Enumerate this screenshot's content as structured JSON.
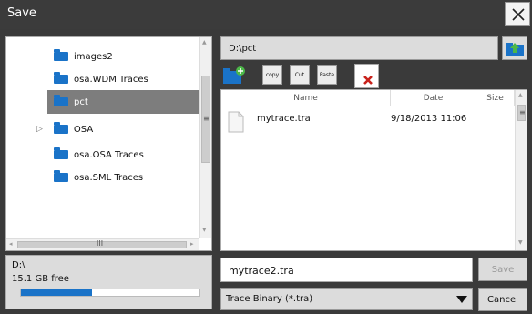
{
  "window": {
    "title": "Save"
  },
  "tree": {
    "items": [
      {
        "label": "images2"
      },
      {
        "label": "osa.WDM Traces"
      },
      {
        "label": "pct",
        "selected": true
      },
      {
        "label": "OSA",
        "expandable": true
      },
      {
        "label": "osa.OSA Traces"
      },
      {
        "label": "osa.SML Traces"
      }
    ],
    "scroll_h_label": "III",
    "scroll_v_label": "≡"
  },
  "drive": {
    "name": "D:\\",
    "free_text": "15.1 GB  free",
    "used_fraction": 0.4
  },
  "path": {
    "current": "D:\\pct"
  },
  "toolbar": {
    "copy_label": "copy",
    "cut_label": "Cut",
    "paste_label": "Paste"
  },
  "filelist": {
    "columns": [
      "Name",
      "Date",
      "Size"
    ],
    "rows": [
      {
        "name": "mytrace.tra",
        "date": "9/18/2013 11:06",
        "size": ""
      }
    ]
  },
  "filename": {
    "value": "mytrace2.tra"
  },
  "filetype": {
    "selected": "Trace Binary (*.tra)"
  },
  "buttons": {
    "save": "Save",
    "cancel": "Cancel"
  },
  "colors": {
    "accent": "#1a73c8",
    "title_bg": "#3b3b3b",
    "selected_bg": "#7d7d7d"
  }
}
